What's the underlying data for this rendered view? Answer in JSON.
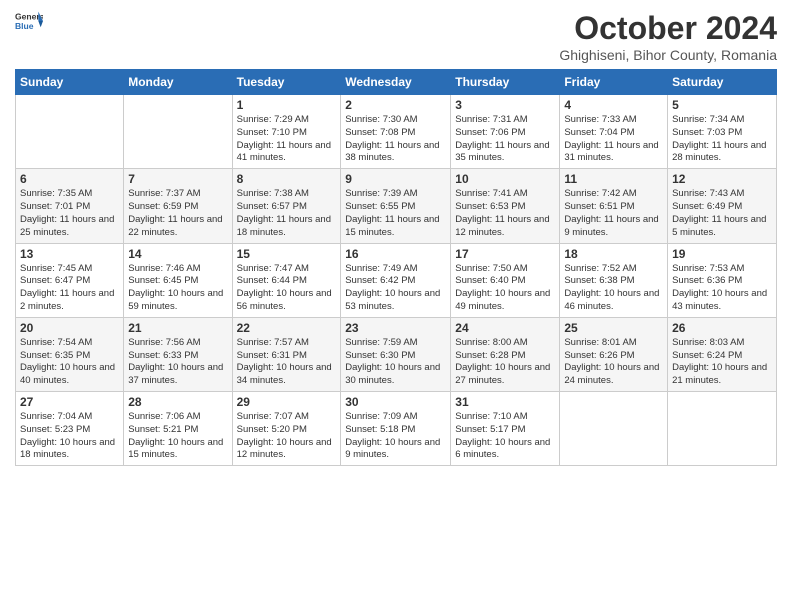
{
  "header": {
    "logo_general": "General",
    "logo_blue": "Blue",
    "month_year": "October 2024",
    "location": "Ghighiseni, Bihor County, Romania"
  },
  "days_of_week": [
    "Sunday",
    "Monday",
    "Tuesday",
    "Wednesday",
    "Thursday",
    "Friday",
    "Saturday"
  ],
  "weeks": [
    [
      {
        "day": "",
        "info": ""
      },
      {
        "day": "",
        "info": ""
      },
      {
        "day": "1",
        "info": "Sunrise: 7:29 AM\nSunset: 7:10 PM\nDaylight: 11 hours and 41 minutes."
      },
      {
        "day": "2",
        "info": "Sunrise: 7:30 AM\nSunset: 7:08 PM\nDaylight: 11 hours and 38 minutes."
      },
      {
        "day": "3",
        "info": "Sunrise: 7:31 AM\nSunset: 7:06 PM\nDaylight: 11 hours and 35 minutes."
      },
      {
        "day": "4",
        "info": "Sunrise: 7:33 AM\nSunset: 7:04 PM\nDaylight: 11 hours and 31 minutes."
      },
      {
        "day": "5",
        "info": "Sunrise: 7:34 AM\nSunset: 7:03 PM\nDaylight: 11 hours and 28 minutes."
      }
    ],
    [
      {
        "day": "6",
        "info": "Sunrise: 7:35 AM\nSunset: 7:01 PM\nDaylight: 11 hours and 25 minutes."
      },
      {
        "day": "7",
        "info": "Sunrise: 7:37 AM\nSunset: 6:59 PM\nDaylight: 11 hours and 22 minutes."
      },
      {
        "day": "8",
        "info": "Sunrise: 7:38 AM\nSunset: 6:57 PM\nDaylight: 11 hours and 18 minutes."
      },
      {
        "day": "9",
        "info": "Sunrise: 7:39 AM\nSunset: 6:55 PM\nDaylight: 11 hours and 15 minutes."
      },
      {
        "day": "10",
        "info": "Sunrise: 7:41 AM\nSunset: 6:53 PM\nDaylight: 11 hours and 12 minutes."
      },
      {
        "day": "11",
        "info": "Sunrise: 7:42 AM\nSunset: 6:51 PM\nDaylight: 11 hours and 9 minutes."
      },
      {
        "day": "12",
        "info": "Sunrise: 7:43 AM\nSunset: 6:49 PM\nDaylight: 11 hours and 5 minutes."
      }
    ],
    [
      {
        "day": "13",
        "info": "Sunrise: 7:45 AM\nSunset: 6:47 PM\nDaylight: 11 hours and 2 minutes."
      },
      {
        "day": "14",
        "info": "Sunrise: 7:46 AM\nSunset: 6:45 PM\nDaylight: 10 hours and 59 minutes."
      },
      {
        "day": "15",
        "info": "Sunrise: 7:47 AM\nSunset: 6:44 PM\nDaylight: 10 hours and 56 minutes."
      },
      {
        "day": "16",
        "info": "Sunrise: 7:49 AM\nSunset: 6:42 PM\nDaylight: 10 hours and 53 minutes."
      },
      {
        "day": "17",
        "info": "Sunrise: 7:50 AM\nSunset: 6:40 PM\nDaylight: 10 hours and 49 minutes."
      },
      {
        "day": "18",
        "info": "Sunrise: 7:52 AM\nSunset: 6:38 PM\nDaylight: 10 hours and 46 minutes."
      },
      {
        "day": "19",
        "info": "Sunrise: 7:53 AM\nSunset: 6:36 PM\nDaylight: 10 hours and 43 minutes."
      }
    ],
    [
      {
        "day": "20",
        "info": "Sunrise: 7:54 AM\nSunset: 6:35 PM\nDaylight: 10 hours and 40 minutes."
      },
      {
        "day": "21",
        "info": "Sunrise: 7:56 AM\nSunset: 6:33 PM\nDaylight: 10 hours and 37 minutes."
      },
      {
        "day": "22",
        "info": "Sunrise: 7:57 AM\nSunset: 6:31 PM\nDaylight: 10 hours and 34 minutes."
      },
      {
        "day": "23",
        "info": "Sunrise: 7:59 AM\nSunset: 6:30 PM\nDaylight: 10 hours and 30 minutes."
      },
      {
        "day": "24",
        "info": "Sunrise: 8:00 AM\nSunset: 6:28 PM\nDaylight: 10 hours and 27 minutes."
      },
      {
        "day": "25",
        "info": "Sunrise: 8:01 AM\nSunset: 6:26 PM\nDaylight: 10 hours and 24 minutes."
      },
      {
        "day": "26",
        "info": "Sunrise: 8:03 AM\nSunset: 6:24 PM\nDaylight: 10 hours and 21 minutes."
      }
    ],
    [
      {
        "day": "27",
        "info": "Sunrise: 7:04 AM\nSunset: 5:23 PM\nDaylight: 10 hours and 18 minutes."
      },
      {
        "day": "28",
        "info": "Sunrise: 7:06 AM\nSunset: 5:21 PM\nDaylight: 10 hours and 15 minutes."
      },
      {
        "day": "29",
        "info": "Sunrise: 7:07 AM\nSunset: 5:20 PM\nDaylight: 10 hours and 12 minutes."
      },
      {
        "day": "30",
        "info": "Sunrise: 7:09 AM\nSunset: 5:18 PM\nDaylight: 10 hours and 9 minutes."
      },
      {
        "day": "31",
        "info": "Sunrise: 7:10 AM\nSunset: 5:17 PM\nDaylight: 10 hours and 6 minutes."
      },
      {
        "day": "",
        "info": ""
      },
      {
        "day": "",
        "info": ""
      }
    ]
  ]
}
